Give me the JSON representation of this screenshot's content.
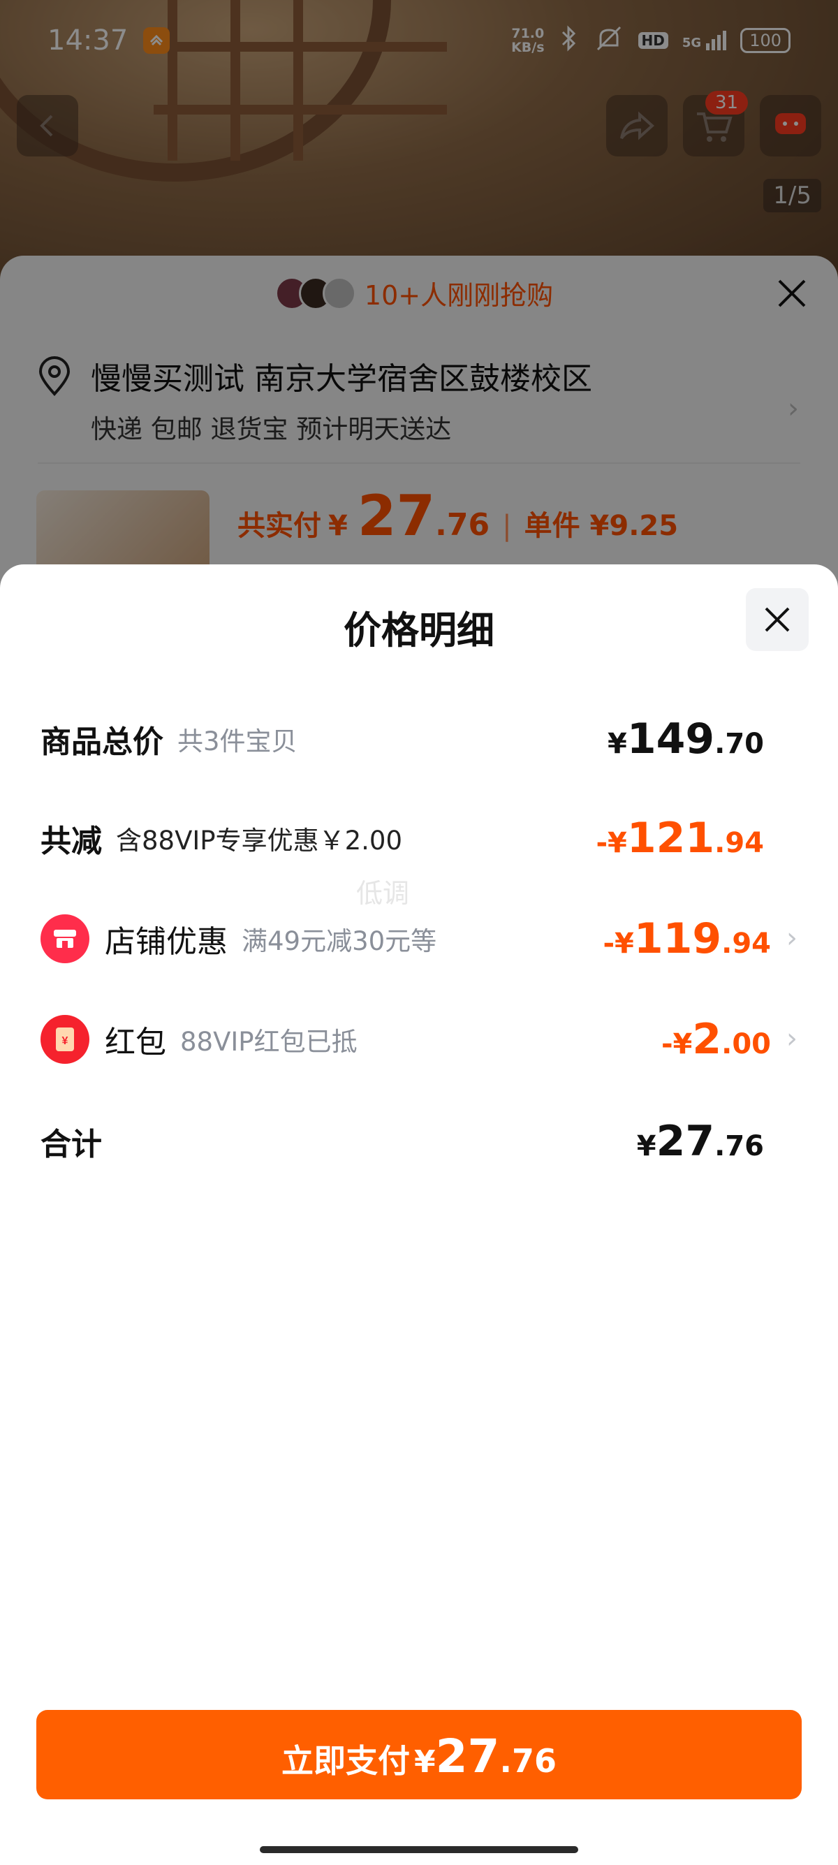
{
  "status_bar": {
    "time": "14:37",
    "speed_top": "71.0",
    "speed_bottom": "KB/s",
    "network": "5G",
    "hd": "HD",
    "battery": "100"
  },
  "product_page": {
    "cart_count": "31",
    "pager": "1/5",
    "buyers_text": "10+人刚刚抢购",
    "address_main": "慢慢买测试 南京大学宿舍区鼓楼校区",
    "address_sub": "快递 包邮 退货宝 预计明天送达",
    "paid_label": "共实付",
    "paid_symbol": "¥",
    "paid_int": "27",
    "paid_dec": ".76",
    "unit_price": "单件 ¥9.25"
  },
  "price_detail": {
    "title": "价格明细",
    "watermark": "低调",
    "rows": [
      {
        "label": "商品总价",
        "sub": "共3件宝贝",
        "sym": "¥",
        "int": "149",
        "dec": ".70"
      },
      {
        "label": "共减",
        "sub": "含88VIP专享优惠￥2.00",
        "sym": "-¥",
        "int": "121",
        "dec": ".94"
      },
      {
        "label": "店铺优惠",
        "sub": "满49元减30元等",
        "sym": "-¥",
        "int": "119",
        "dec": ".94"
      },
      {
        "label": "红包",
        "sub": "88VIP红包已抵",
        "sym": "-¥",
        "int": "2",
        "dec": ".00"
      },
      {
        "label": "合计",
        "sub": "",
        "sym": "¥",
        "int": "27",
        "dec": ".76"
      }
    ],
    "pay_button": {
      "label": "立即支付",
      "sym": "¥",
      "int": "27",
      "dec": ".76"
    }
  },
  "colors": {
    "accent": "#ff5f00",
    "discount": "#ff5000",
    "shop_icon": "#ff2d4b",
    "redpacket_icon": "#f5222d"
  }
}
